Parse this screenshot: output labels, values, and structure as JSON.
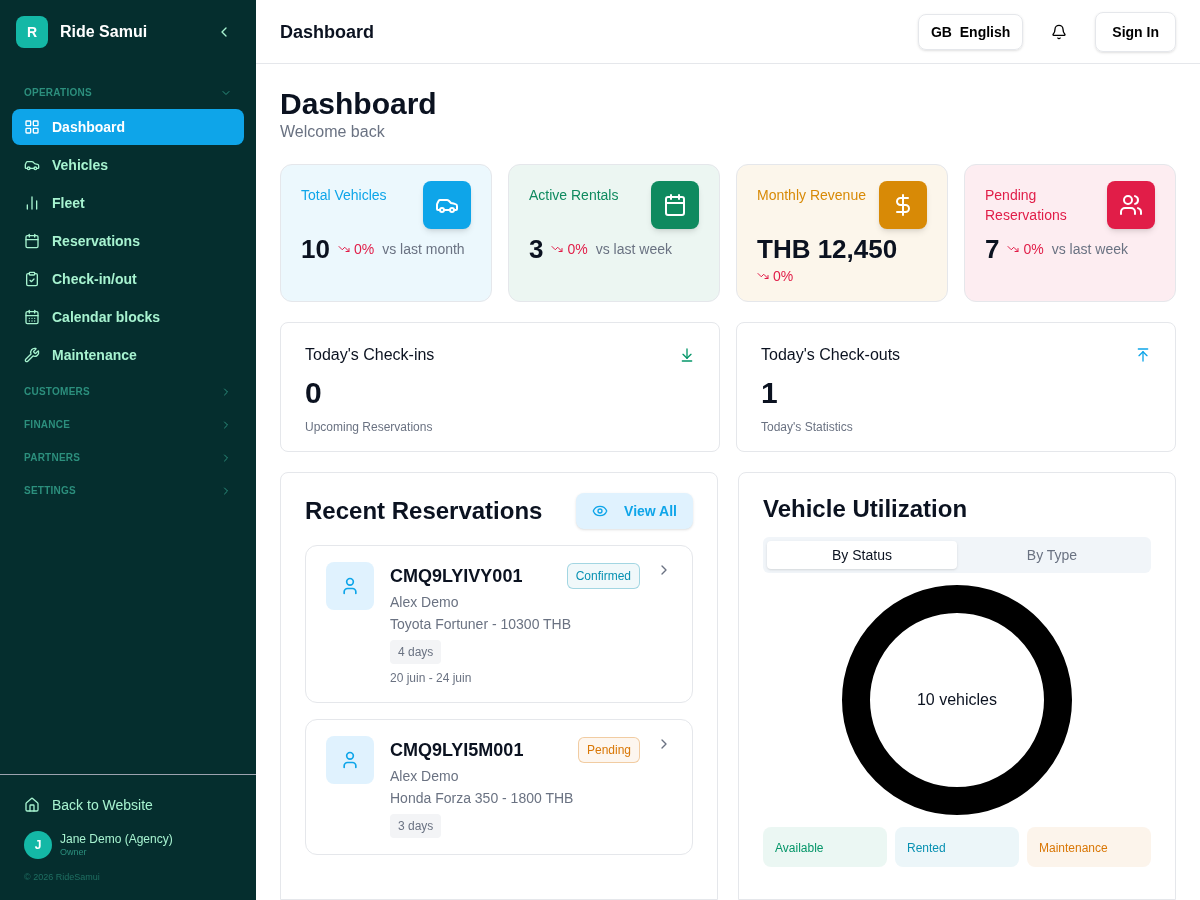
{
  "brand": {
    "logo": "R",
    "name": "Ride Samui"
  },
  "sidebar": {
    "sections": [
      {
        "label": "OPERATIONS",
        "expanded": true,
        "items": [
          {
            "label": "Dashboard",
            "selected": true
          },
          {
            "label": "Vehicles",
            "selected": false
          },
          {
            "label": "Fleet",
            "selected": false
          },
          {
            "label": "Reservations",
            "selected": false
          },
          {
            "label": "Check-in/out",
            "selected": false
          },
          {
            "label": "Calendar blocks",
            "selected": false
          },
          {
            "label": "Maintenance",
            "selected": false
          }
        ]
      },
      {
        "label": "CUSTOMERS",
        "expanded": false
      },
      {
        "label": "FINANCE",
        "expanded": false
      },
      {
        "label": "PARTNERS",
        "expanded": false
      },
      {
        "label": "SETTINGS",
        "expanded": false
      }
    ],
    "back_link": "Back to Website",
    "user": {
      "initial": "J",
      "name": "Jane Demo (Agency)",
      "role": "Owner"
    },
    "copyright": "© 2026 RideSamui"
  },
  "header": {
    "title": "Dashboard",
    "language": "GB  English",
    "sign_in": "Sign In"
  },
  "page": {
    "title": "Dashboard",
    "subtitle": "Welcome back"
  },
  "stats": [
    {
      "label": "Total Vehicles",
      "value": "10",
      "trend": "0%",
      "comparison": "vs last month",
      "color": "#0ea5e9"
    },
    {
      "label": "Active Rentals",
      "value": "3",
      "trend": "0%",
      "comparison": "vs last week",
      "color": "#0f8a5f"
    },
    {
      "label": "Monthly Revenue",
      "value": "THB 12,450",
      "trend": "0%",
      "color": "#d88a06"
    },
    {
      "label": "Pending Reservations",
      "value": "7",
      "trend": "0%",
      "comparison": "vs last week",
      "color": "#e11d48"
    }
  ],
  "today": [
    {
      "title": "Today's Check-ins",
      "value": "0",
      "caption": "Upcoming Reservations",
      "kind": "in"
    },
    {
      "title": "Today's Check-outs",
      "value": "1",
      "caption": "Today's Statistics",
      "kind": "out"
    }
  ],
  "recent": {
    "title": "Recent Reservations",
    "view_all": "View All",
    "items": [
      {
        "code": "CMQ9LYIVY001",
        "status": "Confirmed",
        "color": "#0891b2",
        "customer": "Alex Demo",
        "vehicle": "Toyota Fortuner - 10300 THB",
        "duration": "4 days",
        "dates": "20 juin - 24 juin"
      },
      {
        "code": "CMQ9LYI5M001",
        "status": "Pending",
        "color": "#d97706",
        "customer": "Alex Demo",
        "vehicle": "Honda Forza 350 - 1800 THB",
        "duration": "3 days"
      }
    ]
  },
  "utilization": {
    "title": "Vehicle Utilization",
    "tabs": [
      {
        "label": "By Status",
        "selected": true
      },
      {
        "label": "By Type",
        "selected": false
      }
    ],
    "center_label": "10 vehicles",
    "statuses": [
      {
        "label": "Available",
        "color": "#059669"
      },
      {
        "label": "Rented",
        "color": "#0891b2"
      },
      {
        "label": "Maintenance",
        "color": "#d97706"
      }
    ]
  }
}
